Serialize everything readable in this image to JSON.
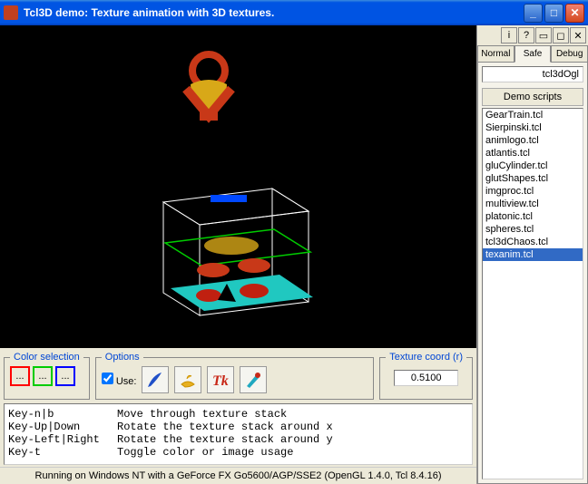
{
  "window": {
    "title": "Tcl3D demo: Texture animation with 3D textures."
  },
  "toolbar_icons": [
    "i",
    "?",
    "▭",
    "◻",
    "✕"
  ],
  "tabs": [
    {
      "label": "Normal",
      "active": false
    },
    {
      "label": "Safe",
      "active": true
    },
    {
      "label": "Debug",
      "active": false
    }
  ],
  "package_input": "tcl3dOgl",
  "demo_label": "Demo scripts",
  "scripts": [
    "GearTrain.tcl",
    "Sierpinski.tcl",
    "animlogo.tcl",
    "atlantis.tcl",
    "gluCylinder.tcl",
    "glutShapes.tcl",
    "imgproc.tcl",
    "multiview.tcl",
    "platonic.tcl",
    "spheres.tcl",
    "tcl3dChaos.tcl",
    "texanim.tcl"
  ],
  "selected_script": "texanim.tcl",
  "color_section": {
    "legend": "Color selection",
    "swatch_text": "..."
  },
  "options": {
    "legend": "Options",
    "use_label": "Use:"
  },
  "texcoord": {
    "legend": "Texture coord (r)",
    "value": "0.5100"
  },
  "help": [
    {
      "key": "Key-n|b",
      "desc": "Move through texture stack"
    },
    {
      "key": "Key-Up|Down",
      "desc": "Rotate the texture stack around x"
    },
    {
      "key": "Key-Left|Right",
      "desc": "Rotate the texture stack around y"
    },
    {
      "key": "Key-t",
      "desc": "Toggle color or image usage"
    }
  ],
  "status": "Running on Windows NT with a GeForce FX Go5600/AGP/SSE2 (OpenGL 1.4.0, Tcl 8.4.16)"
}
